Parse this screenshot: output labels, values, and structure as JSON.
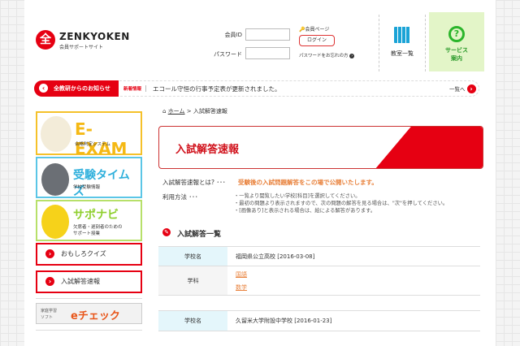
{
  "header": {
    "brand": "ZENKYOKEN",
    "subtitle": "会員サポートサイト",
    "logo_mark": "全",
    "member_id_label": "会員ID",
    "password_label": "パスワード",
    "member_page_label": "会員ページ",
    "login_button": "ログイン",
    "forgot_password": "パスワードをお忘れの方",
    "classroom_list": "教室一覧",
    "service_line1": "サービス",
    "service_line2": "案内"
  },
  "news": {
    "tab_label": "全教研からのお知らせ",
    "tag": "新着情報",
    "separator": "|",
    "message": "エコール守恒の行事予定表が更新されました。",
    "list_link": "一覧へ"
  },
  "sidebar": {
    "eexam": {
      "title": "E-EXAM",
      "sub": "合格判定システム"
    },
    "juken": {
      "title": "受験タイムズ",
      "sub": "学校受験情報"
    },
    "sapo": {
      "title": "サポナビ",
      "sub1": "欠席者・遅刻者のための",
      "sub2": "サポート授業"
    },
    "quiz": "おもしろクイズ",
    "answers": "入試解答速報",
    "echeck": {
      "small1": "家庭学習",
      "small2": "ソフト",
      "title": "eチェック"
    }
  },
  "breadcrumb": {
    "home": "ホーム",
    "sep": ">",
    "current": "入試解答速報"
  },
  "main": {
    "banner_title": "入試解答速報",
    "about_label": "入試解答速報とは? ･･･",
    "about_text": "受験後の入試問題解答をこの場で公開いたします。",
    "usage_label": "利用方法 ･･･",
    "usage": [
      "・一覧より閲覧したい学校[科目]を選択してください。",
      "・最初の問題より表示されますので、次の問題の解答を見る場合は、\"次\"を押してください。",
      "・[画像あり]と表示される場合は、絵による解答があります。"
    ],
    "list_heading": "入試解答一覧",
    "tables": [
      {
        "school_label": "学校名",
        "school": "福岡県公立高校 [2016-03-08]",
        "subject_label": "学科",
        "subjects": [
          "国語",
          "数学"
        ]
      },
      {
        "school_label": "学校名",
        "school": "久留米大学附設中学校 [2016-01-23]"
      }
    ]
  },
  "colors": {
    "brand_red": "#e60012",
    "accent_orange": "#e8803a",
    "service_green": "#e3f5c8",
    "table_header": "#e4f6fb"
  }
}
